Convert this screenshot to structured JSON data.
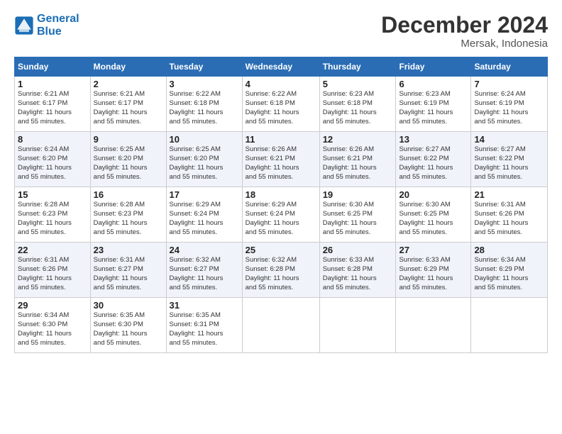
{
  "logo": {
    "line1": "General",
    "line2": "Blue"
  },
  "title": "December 2024",
  "location": "Mersak, Indonesia",
  "days_of_week": [
    "Sunday",
    "Monday",
    "Tuesday",
    "Wednesday",
    "Thursday",
    "Friday",
    "Saturday"
  ],
  "weeks": [
    [
      {
        "day": "1",
        "sunrise": "6:21 AM",
        "sunset": "6:17 PM",
        "daylight": "11 hours and 55 minutes."
      },
      {
        "day": "2",
        "sunrise": "6:21 AM",
        "sunset": "6:17 PM",
        "daylight": "11 hours and 55 minutes."
      },
      {
        "day": "3",
        "sunrise": "6:22 AM",
        "sunset": "6:18 PM",
        "daylight": "11 hours and 55 minutes."
      },
      {
        "day": "4",
        "sunrise": "6:22 AM",
        "sunset": "6:18 PM",
        "daylight": "11 hours and 55 minutes."
      },
      {
        "day": "5",
        "sunrise": "6:23 AM",
        "sunset": "6:18 PM",
        "daylight": "11 hours and 55 minutes."
      },
      {
        "day": "6",
        "sunrise": "6:23 AM",
        "sunset": "6:19 PM",
        "daylight": "11 hours and 55 minutes."
      },
      {
        "day": "7",
        "sunrise": "6:24 AM",
        "sunset": "6:19 PM",
        "daylight": "11 hours and 55 minutes."
      }
    ],
    [
      {
        "day": "8",
        "sunrise": "6:24 AM",
        "sunset": "6:20 PM",
        "daylight": "11 hours and 55 minutes."
      },
      {
        "day": "9",
        "sunrise": "6:25 AM",
        "sunset": "6:20 PM",
        "daylight": "11 hours and 55 minutes."
      },
      {
        "day": "10",
        "sunrise": "6:25 AM",
        "sunset": "6:20 PM",
        "daylight": "11 hours and 55 minutes."
      },
      {
        "day": "11",
        "sunrise": "6:26 AM",
        "sunset": "6:21 PM",
        "daylight": "11 hours and 55 minutes."
      },
      {
        "day": "12",
        "sunrise": "6:26 AM",
        "sunset": "6:21 PM",
        "daylight": "11 hours and 55 minutes."
      },
      {
        "day": "13",
        "sunrise": "6:27 AM",
        "sunset": "6:22 PM",
        "daylight": "11 hours and 55 minutes."
      },
      {
        "day": "14",
        "sunrise": "6:27 AM",
        "sunset": "6:22 PM",
        "daylight": "11 hours and 55 minutes."
      }
    ],
    [
      {
        "day": "15",
        "sunrise": "6:28 AM",
        "sunset": "6:23 PM",
        "daylight": "11 hours and 55 minutes."
      },
      {
        "day": "16",
        "sunrise": "6:28 AM",
        "sunset": "6:23 PM",
        "daylight": "11 hours and 55 minutes."
      },
      {
        "day": "17",
        "sunrise": "6:29 AM",
        "sunset": "6:24 PM",
        "daylight": "11 hours and 55 minutes."
      },
      {
        "day": "18",
        "sunrise": "6:29 AM",
        "sunset": "6:24 PM",
        "daylight": "11 hours and 55 minutes."
      },
      {
        "day": "19",
        "sunrise": "6:30 AM",
        "sunset": "6:25 PM",
        "daylight": "11 hours and 55 minutes."
      },
      {
        "day": "20",
        "sunrise": "6:30 AM",
        "sunset": "6:25 PM",
        "daylight": "11 hours and 55 minutes."
      },
      {
        "day": "21",
        "sunrise": "6:31 AM",
        "sunset": "6:26 PM",
        "daylight": "11 hours and 55 minutes."
      }
    ],
    [
      {
        "day": "22",
        "sunrise": "6:31 AM",
        "sunset": "6:26 PM",
        "daylight": "11 hours and 55 minutes."
      },
      {
        "day": "23",
        "sunrise": "6:31 AM",
        "sunset": "6:27 PM",
        "daylight": "11 hours and 55 minutes."
      },
      {
        "day": "24",
        "sunrise": "6:32 AM",
        "sunset": "6:27 PM",
        "daylight": "11 hours and 55 minutes."
      },
      {
        "day": "25",
        "sunrise": "6:32 AM",
        "sunset": "6:28 PM",
        "daylight": "11 hours and 55 minutes."
      },
      {
        "day": "26",
        "sunrise": "6:33 AM",
        "sunset": "6:28 PM",
        "daylight": "11 hours and 55 minutes."
      },
      {
        "day": "27",
        "sunrise": "6:33 AM",
        "sunset": "6:29 PM",
        "daylight": "11 hours and 55 minutes."
      },
      {
        "day": "28",
        "sunrise": "6:34 AM",
        "sunset": "6:29 PM",
        "daylight": "11 hours and 55 minutes."
      }
    ],
    [
      {
        "day": "29",
        "sunrise": "6:34 AM",
        "sunset": "6:30 PM",
        "daylight": "11 hours and 55 minutes."
      },
      {
        "day": "30",
        "sunrise": "6:35 AM",
        "sunset": "6:30 PM",
        "daylight": "11 hours and 55 minutes."
      },
      {
        "day": "31",
        "sunrise": "6:35 AM",
        "sunset": "6:31 PM",
        "daylight": "11 hours and 55 minutes."
      },
      null,
      null,
      null,
      null
    ]
  ],
  "labels": {
    "sunrise": "Sunrise: ",
    "sunset": "Sunset: ",
    "daylight": "Daylight: "
  }
}
